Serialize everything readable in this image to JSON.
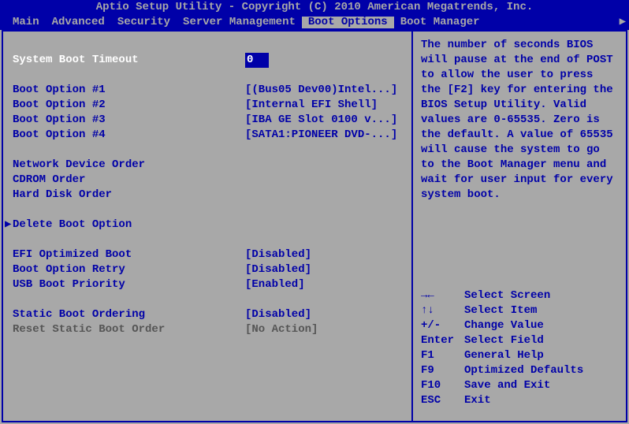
{
  "title": "Aptio Setup Utility - Copyright (C) 2010 American Megatrends, Inc.",
  "menu": {
    "items": [
      "Main",
      "Advanced",
      "Security",
      "Server Management",
      "Boot Options",
      "Boot Manager"
    ],
    "active_index": 4,
    "arrow": "▶"
  },
  "fields": {
    "timeout": {
      "label": "System Boot Timeout",
      "value": "0"
    },
    "boot1": {
      "label": "Boot Option #1",
      "value": "[(Bus05 Dev00)Intel...]"
    },
    "boot2": {
      "label": "Boot Option #2",
      "value": "[Internal EFI Shell]"
    },
    "boot3": {
      "label": "Boot Option #3",
      "value": "[IBA GE Slot 0100 v...]"
    },
    "boot4": {
      "label": "Boot Option #4",
      "value": "[SATA1:PIONEER DVD-...]"
    },
    "network_order": {
      "label": "Network Device Order"
    },
    "cdrom_order": {
      "label": "CDROM Order"
    },
    "hdd_order": {
      "label": "Hard Disk Order"
    },
    "delete_boot": {
      "label": "Delete Boot Option",
      "marker": "▶"
    },
    "efi_opt": {
      "label": "EFI Optimized Boot",
      "value": "[Disabled]"
    },
    "boot_retry": {
      "label": "Boot Option Retry",
      "value": "[Disabled]"
    },
    "usb_priority": {
      "label": "USB Boot Priority",
      "value": "[Enabled]"
    },
    "static_order": {
      "label": "Static Boot Ordering",
      "value": "[Disabled]"
    },
    "reset_static": {
      "label": "Reset Static Boot Order",
      "value": "[No Action]"
    }
  },
  "help": {
    "text": "The number of seconds BIOS will pause at the end of POST to allow the user to press the [F2] key for entering the BIOS Setup Utility.\nValid values are 0-65535. Zero is the default. A value of 65535 will cause the system to go to the Boot Manager menu and wait for user input for every system boot."
  },
  "keys": [
    {
      "key": "→←",
      "action": "Select Screen"
    },
    {
      "key": "↑↓",
      "action": "Select Item"
    },
    {
      "key": "+/-",
      "action": "Change Value"
    },
    {
      "key": "Enter",
      "action": "Select Field"
    },
    {
      "key": "F1",
      "action": "General Help"
    },
    {
      "key": "F9",
      "action": "Optimized Defaults"
    },
    {
      "key": "F10",
      "action": "Save and Exit"
    },
    {
      "key": "ESC",
      "action": "Exit"
    }
  ]
}
